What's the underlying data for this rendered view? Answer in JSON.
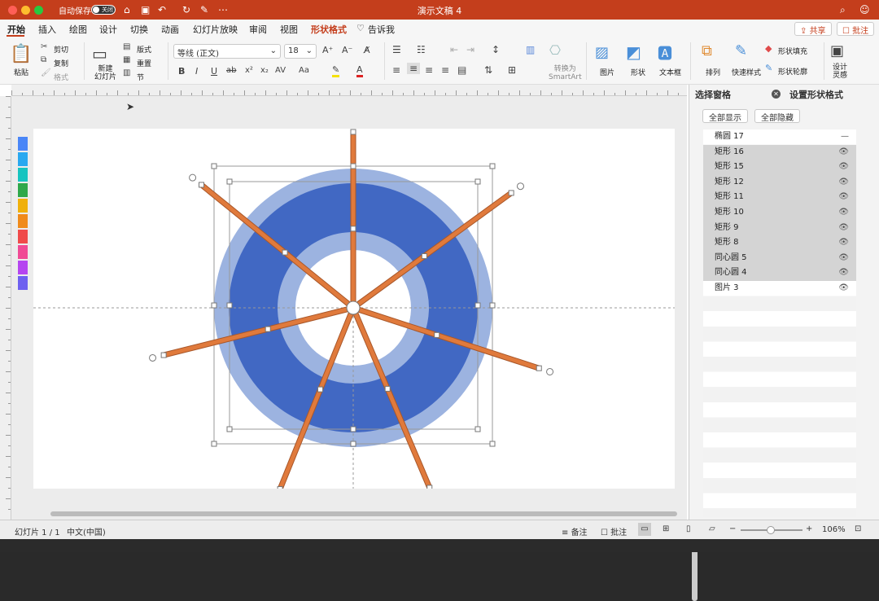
{
  "window": {
    "title": "演示文稿 4",
    "autosave_label": "自动保存",
    "autosave_state": "关闭"
  },
  "tabs": [
    "开始",
    "插入",
    "绘图",
    "设计",
    "切换",
    "动画",
    "幻灯片放映",
    "审阅",
    "视图",
    "形状格式",
    "告诉我"
  ],
  "header_buttons": {
    "share": "共享",
    "comment": "批注"
  },
  "ribbon": {
    "paste": "粘贴",
    "cut": "剪切",
    "copy": "复制",
    "format": "格式",
    "new_slide": "新建\n幻灯片",
    "layout": "版式",
    "reset": "重置",
    "section": "节",
    "font": "等线 (正文)",
    "size": "18",
    "convert_smartart": "转换为\nSmartArt",
    "picture": "图片",
    "shape": "形状",
    "textbox": "文本框",
    "arrange": "排列",
    "quick_styles": "快速样式",
    "shape_fill": "形状填充",
    "shape_outline": "形状轮廓",
    "designer": "设计\n灵感"
  },
  "colors": {
    "accent": "#c43e1c",
    "ring_light": "#9cb3e0",
    "ring_dark": "#4168c3",
    "spoke": "#e07a3c"
  },
  "swatches": [
    "#4a86f7",
    "#29a8f0",
    "#17c4c0",
    "#2ea84a",
    "#f0b00a",
    "#f08a1a",
    "#f04a4a",
    "#f04a95",
    "#b545f0",
    "#6e60f0"
  ],
  "pane": {
    "title": "选择窗格",
    "tab2": "设置形状格式",
    "show_all": "全部显示",
    "hide_all": "全部隐藏",
    "items": [
      {
        "name": "椭圆 17",
        "selected": false,
        "mark": "—"
      },
      {
        "name": "矩形 16",
        "selected": true,
        "mark": "👁"
      },
      {
        "name": "矩形 15",
        "selected": true,
        "mark": "👁"
      },
      {
        "name": "矩形 12",
        "selected": true,
        "mark": "👁"
      },
      {
        "name": "矩形 11",
        "selected": true,
        "mark": "👁"
      },
      {
        "name": "矩形 10",
        "selected": true,
        "mark": "👁"
      },
      {
        "name": "矩形 9",
        "selected": true,
        "mark": "👁"
      },
      {
        "name": "矩形 8",
        "selected": true,
        "mark": "👁"
      },
      {
        "name": "同心圆 5",
        "selected": true,
        "mark": "👁"
      },
      {
        "name": "同心圆 4",
        "selected": true,
        "mark": "👁"
      },
      {
        "name": "图片 3",
        "selected": false,
        "mark": "👁"
      }
    ]
  },
  "status": {
    "slide": "幻灯片 1 / 1",
    "lang": "中文(中国)",
    "notes": "备注",
    "comments": "批注",
    "zoom": "106%"
  }
}
